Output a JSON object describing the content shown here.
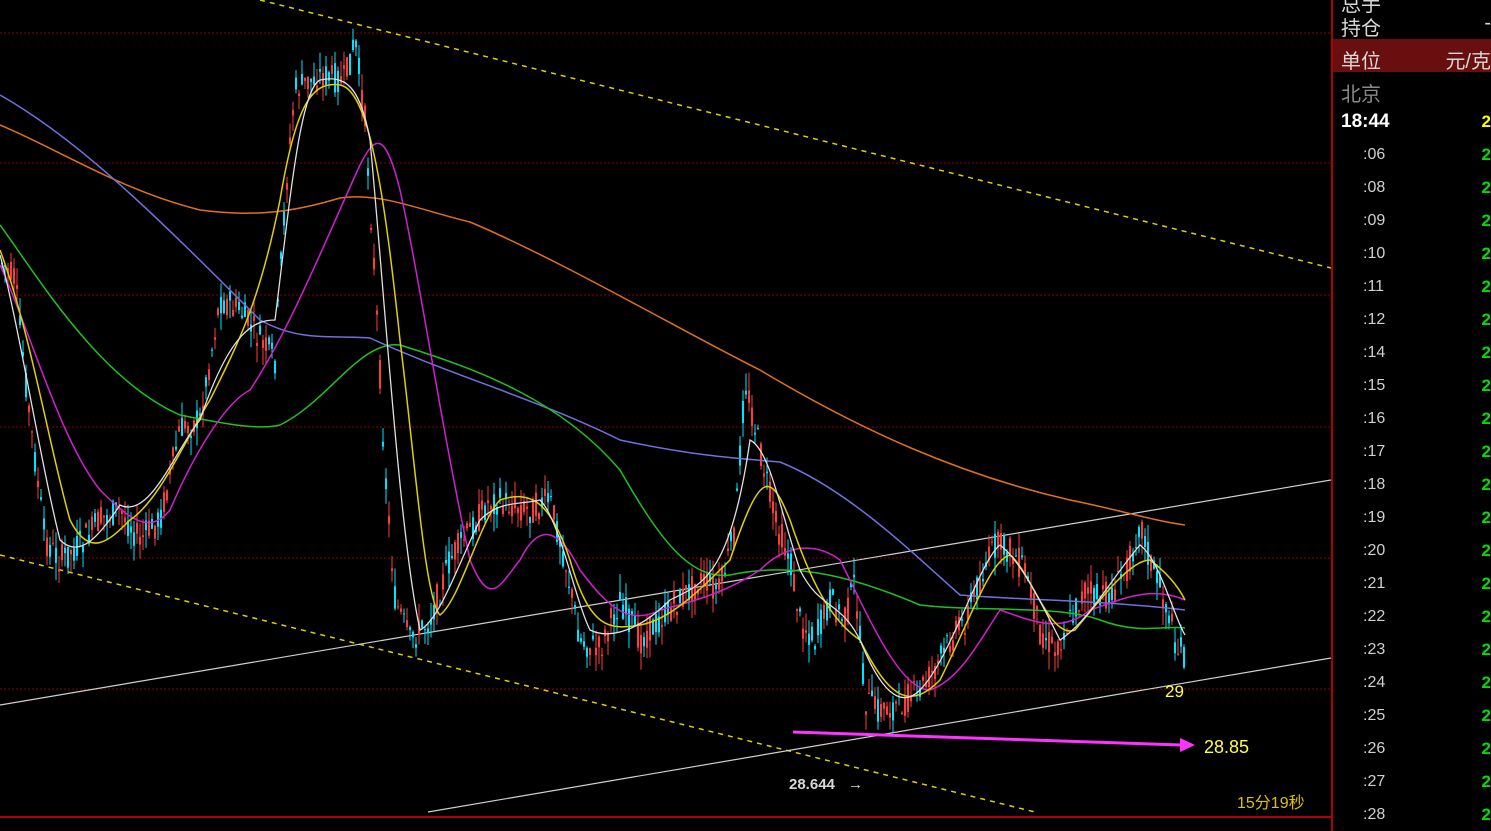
{
  "chart": {
    "annotations": {
      "low_price": "28.644",
      "low_arrow": "→",
      "price_29": "29",
      "target": "28.85",
      "timer": "15分19秒"
    },
    "colors": {
      "background": "#000000",
      "up_candle": "#ff3b3b",
      "down_candle": "#00e5ff",
      "grid": "#8b0000",
      "ma_white": "#e0e0e0",
      "ma_yellow": "#e0d000",
      "ma_magenta": "#d020d0",
      "ma_green": "#20c020",
      "ma_blue": "#7070e0",
      "ma_orange": "#e07020",
      "channel_dashed": "#e0d000",
      "target_arrow": "#ff33ff"
    }
  },
  "side_panel": {
    "top_cut_label": "总手",
    "position_label": "持仓",
    "position_value": "-",
    "unit_label": "单位",
    "unit_value": "元/克",
    "city": "北京",
    "current_time": "18:44",
    "current_value": "2",
    "ticks": [
      {
        "time": ":06",
        "value": "2"
      },
      {
        "time": ":08",
        "value": "2"
      },
      {
        "time": ":09",
        "value": "2"
      },
      {
        "time": ":10",
        "value": "2"
      },
      {
        "time": ":11",
        "value": "2"
      },
      {
        "time": ":12",
        "value": "2"
      },
      {
        "time": ":14",
        "value": "2"
      },
      {
        "time": ":15",
        "value": "2"
      },
      {
        "time": ":16",
        "value": "2"
      },
      {
        "time": ":17",
        "value": "2"
      },
      {
        "time": ":18",
        "value": "2"
      },
      {
        "time": ":19",
        "value": "2"
      },
      {
        "time": ":20",
        "value": "2"
      },
      {
        "time": ":21",
        "value": "2"
      },
      {
        "time": ":22",
        "value": "2"
      },
      {
        "time": ":23",
        "value": "2"
      },
      {
        "time": ":24",
        "value": "2"
      },
      {
        "time": ":25",
        "value": "2"
      },
      {
        "time": ":26",
        "value": "2"
      },
      {
        "time": ":27",
        "value": "2"
      },
      {
        "time": ":28",
        "value": "2"
      }
    ]
  }
}
